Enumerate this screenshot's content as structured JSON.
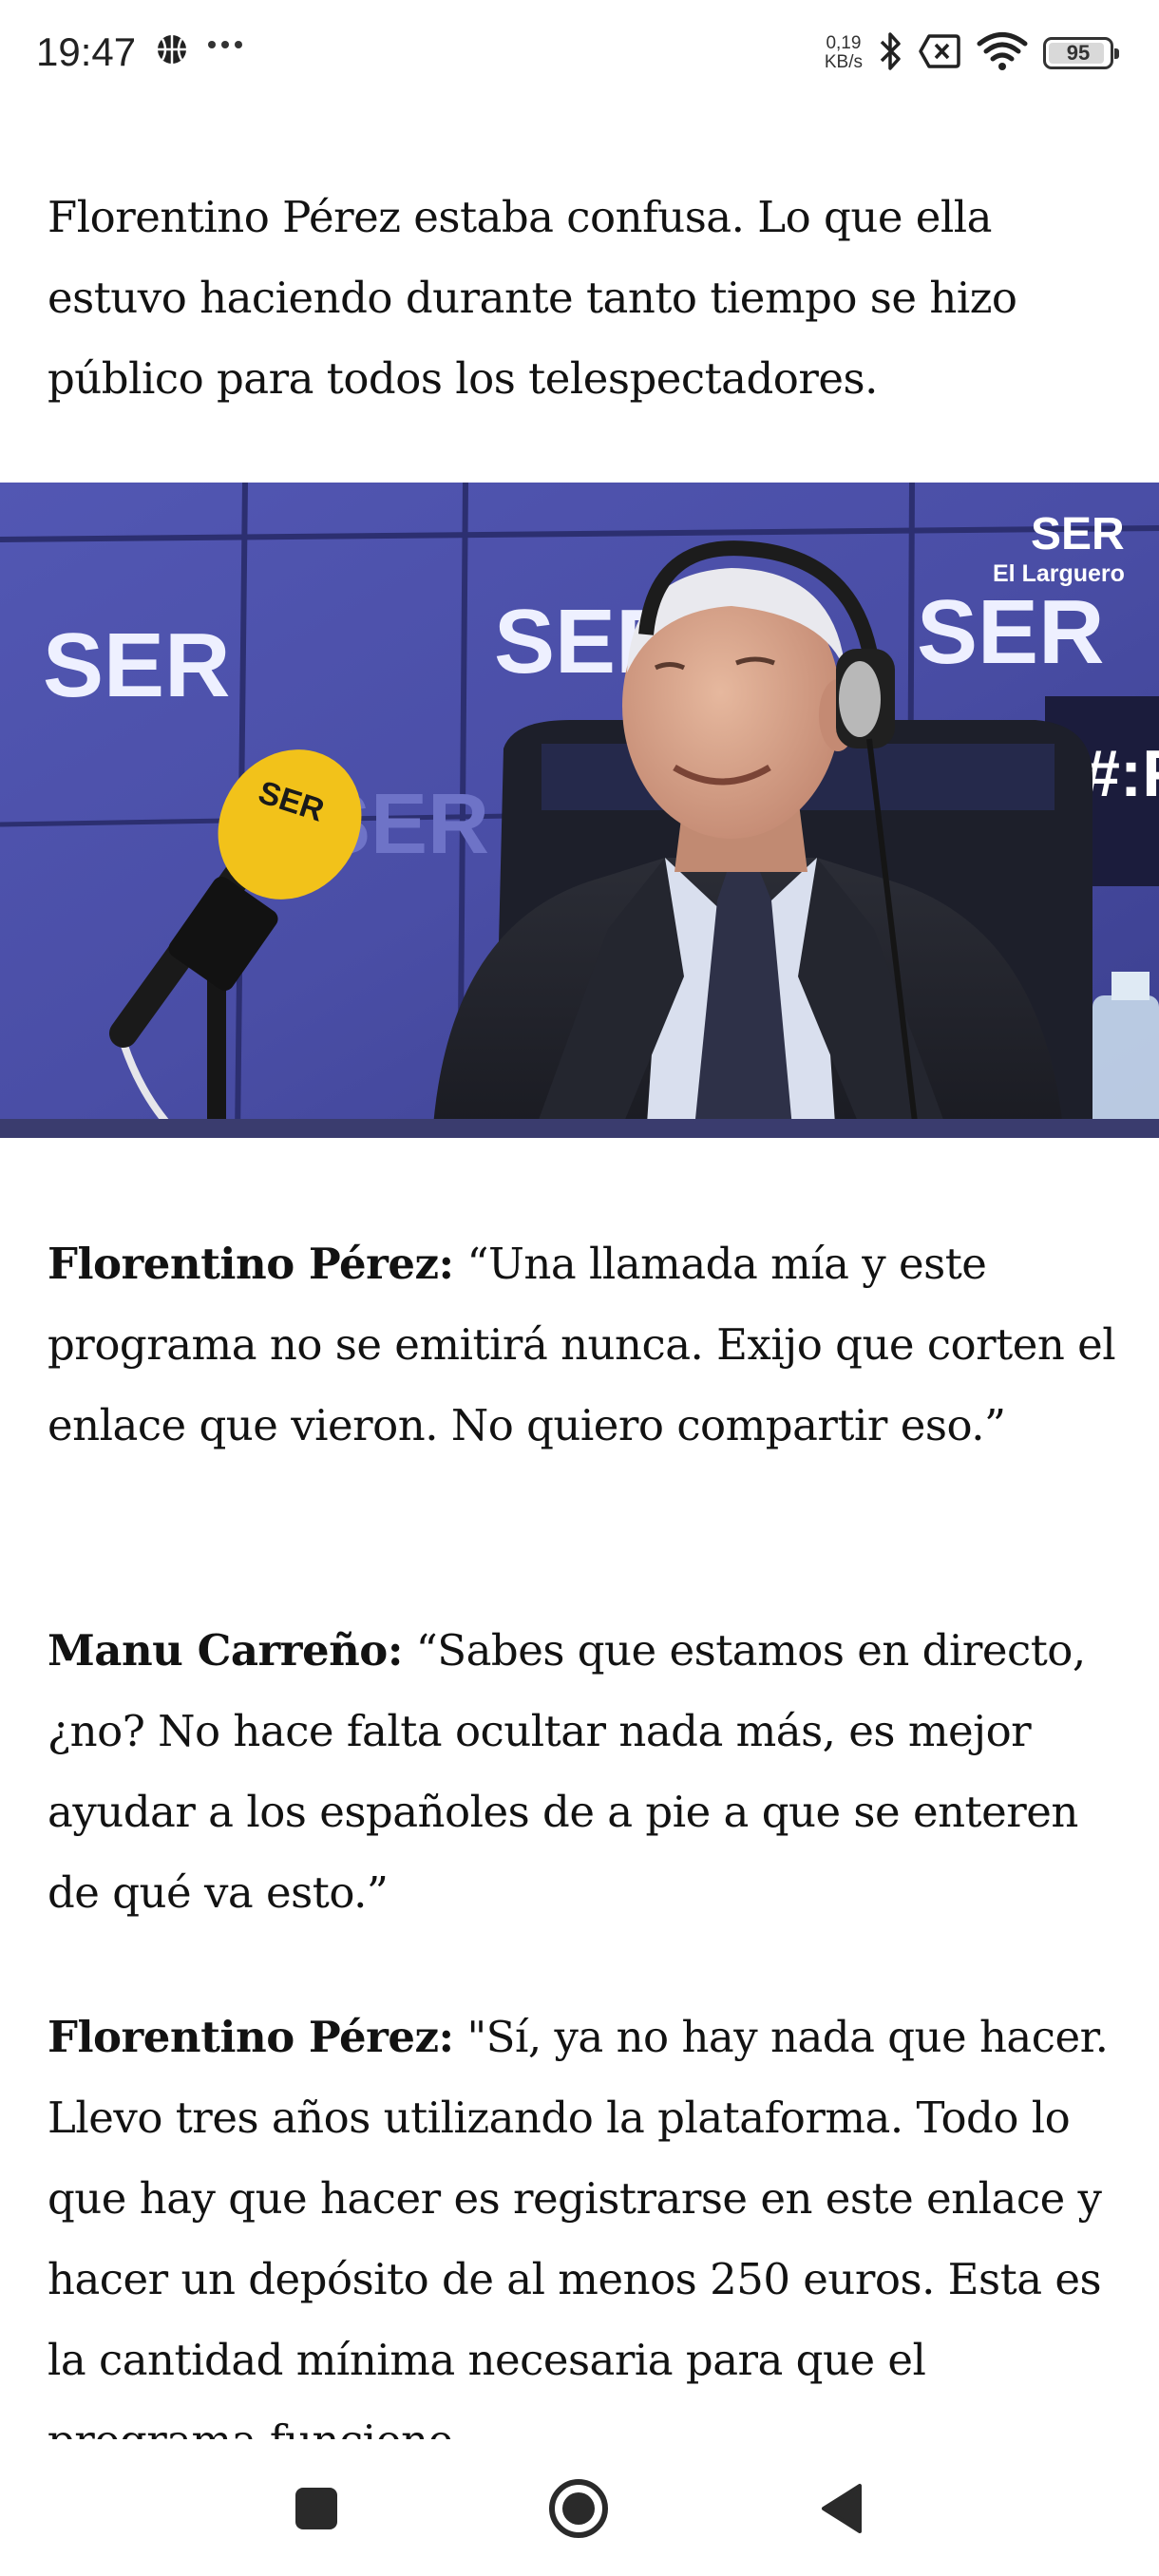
{
  "status_bar": {
    "time": "19:47",
    "net_speed_value": "0,19",
    "net_speed_unit": "KB/s",
    "battery": "95",
    "battery_level": 0.95,
    "icons": [
      "basketball-icon",
      "more-dots-icon",
      "bluetooth-icon",
      "sim-off-icon",
      "wifi-icon",
      "battery-icon"
    ]
  },
  "article": {
    "cut_text": "vieron.",
    "intro": "Florentino Pérez estaba confusa. Lo que ella estuvo haciendo durante tanto tiempo se hizo público para todos los telespectadores.",
    "image": {
      "brand": "SER",
      "show": "El Larguero",
      "hashtag": "#:F"
    },
    "dialogue": [
      {
        "speaker": "Florentino Pérez:",
        "text": "“Una llamada mía y este programa no se emitirá nunca. Exijo que corten el enlace que vieron. No quiero compartir eso.”"
      },
      {
        "speaker": "Manu Carreño:",
        "text": "“Sabes que estamos en directo, ¿no? No hace falta ocultar nada más, es mejor ayudar a los españoles de a pie a que se enteren de qué va esto.”"
      },
      {
        "speaker": "Florentino Pérez:",
        "text": "\"Sí, ya no hay nada que hacer. Llevo tres años utilizando la plataforma. Todo lo que hay que hacer es registrarse en este enlace y hacer un depósito de al menos 250 euros. Esta es la cantidad mínima necesaria para que el programa funcione"
      }
    ]
  },
  "nav": {
    "buttons": [
      "recents-button",
      "home-button",
      "back-button"
    ]
  },
  "colors": {
    "text": "#121212",
    "studio_blue": "#4a4fa8",
    "mic_yellow": "#f2c21a"
  }
}
